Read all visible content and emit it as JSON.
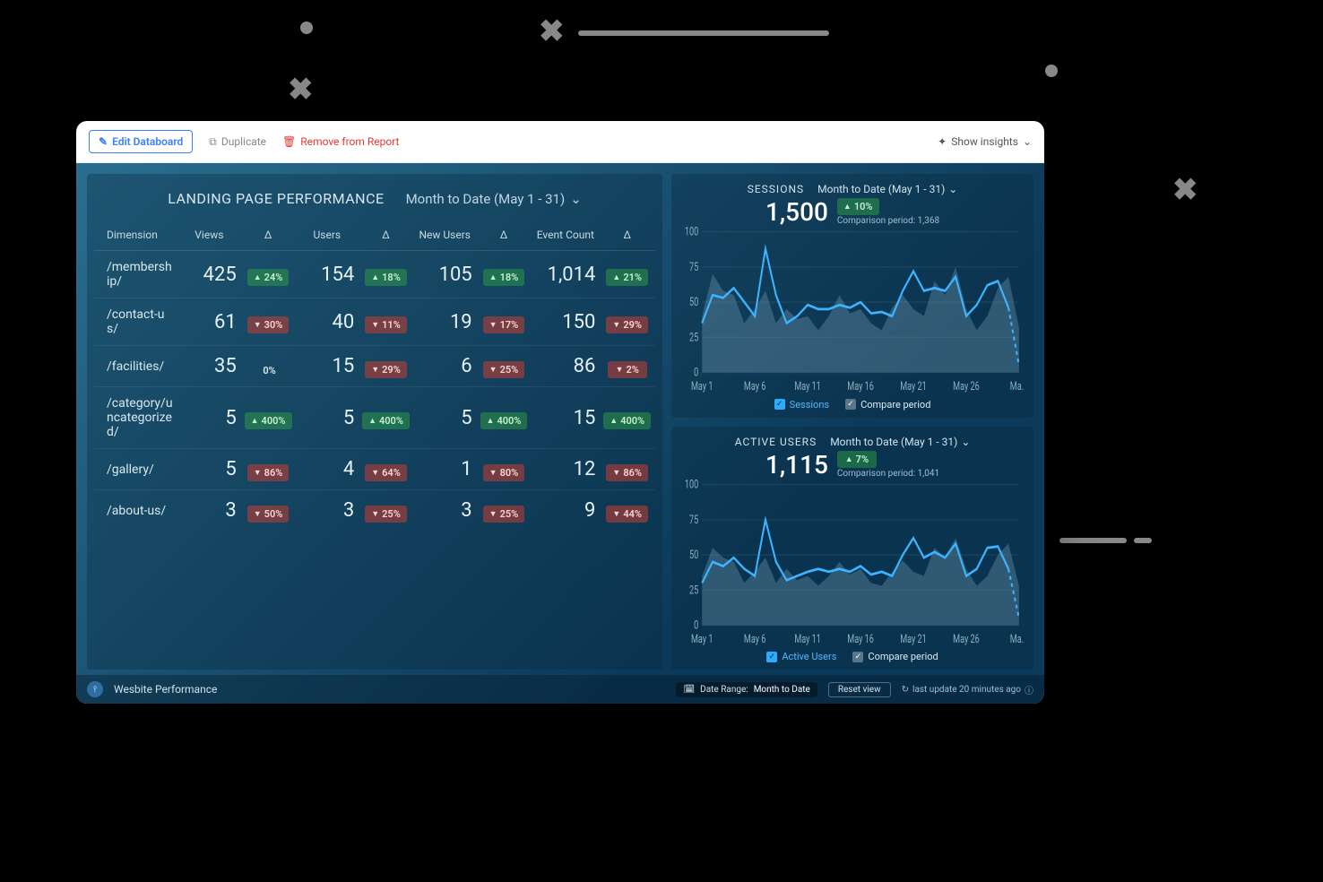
{
  "toolbar": {
    "edit": "Edit Databoard",
    "duplicate": "Duplicate",
    "remove": "Remove from Report",
    "insights": "Show insights"
  },
  "table": {
    "title": "LANDING PAGE PERFORMANCE",
    "range": "Month to Date (May 1 - 31)",
    "columns": {
      "dim": "Dimension",
      "views": "Views",
      "users": "Users",
      "new_users": "New Users",
      "events": "Event Count",
      "delta": "Δ"
    },
    "rows": [
      {
        "dim": "/membership/",
        "views": "425",
        "views_d": {
          "dir": "up",
          "v": "24%"
        },
        "users": "154",
        "users_d": {
          "dir": "up",
          "v": "18%"
        },
        "nu": "105",
        "nu_d": {
          "dir": "up",
          "v": "18%"
        },
        "ev": "1,014",
        "ev_d": {
          "dir": "up",
          "v": "21%"
        }
      },
      {
        "dim": "/contact-us/",
        "views": "61",
        "views_d": {
          "dir": "down",
          "v": "30%"
        },
        "users": "40",
        "users_d": {
          "dir": "down",
          "v": "11%"
        },
        "nu": "19",
        "nu_d": {
          "dir": "down",
          "v": "17%"
        },
        "ev": "150",
        "ev_d": {
          "dir": "down",
          "v": "29%"
        }
      },
      {
        "dim": "/facilities/",
        "views": "35",
        "views_d": {
          "dir": "neutral",
          "v": "0%"
        },
        "users": "15",
        "users_d": {
          "dir": "down",
          "v": "29%"
        },
        "nu": "6",
        "nu_d": {
          "dir": "down",
          "v": "25%"
        },
        "ev": "86",
        "ev_d": {
          "dir": "down",
          "v": "2%"
        }
      },
      {
        "dim": "/category/uncategorized/",
        "views": "5",
        "views_d": {
          "dir": "up",
          "v": "400%"
        },
        "users": "5",
        "users_d": {
          "dir": "up",
          "v": "400%"
        },
        "nu": "5",
        "nu_d": {
          "dir": "up",
          "v": "400%"
        },
        "ev": "15",
        "ev_d": {
          "dir": "up",
          "v": "400%"
        }
      },
      {
        "dim": "/gallery/",
        "views": "5",
        "views_d": {
          "dir": "down",
          "v": "86%"
        },
        "users": "4",
        "users_d": {
          "dir": "down",
          "v": "64%"
        },
        "nu": "1",
        "nu_d": {
          "dir": "down",
          "v": "80%"
        },
        "ev": "12",
        "ev_d": {
          "dir": "down",
          "v": "86%"
        }
      },
      {
        "dim": "/about-us/",
        "views": "3",
        "views_d": {
          "dir": "down",
          "v": "50%"
        },
        "users": "3",
        "users_d": {
          "dir": "down",
          "v": "25%"
        },
        "nu": "3",
        "nu_d": {
          "dir": "down",
          "v": "25%"
        },
        "ev": "9",
        "ev_d": {
          "dir": "down",
          "v": "44%"
        }
      }
    ]
  },
  "sessions_chart": {
    "title": "SESSIONS",
    "range": "Month to Date (May 1 - 31)",
    "value": "1,500",
    "delta": {
      "dir": "up",
      "v": "10%"
    },
    "comparison": "Comparison period: 1,368",
    "legend_primary": "Sessions",
    "legend_compare": "Compare period"
  },
  "users_chart": {
    "title": "ACTIVE USERS",
    "range": "Month to Date (May 1 - 31)",
    "value": "1,115",
    "delta": {
      "dir": "up",
      "v": "7%"
    },
    "comparison": "Comparison period: 1,041",
    "legend_primary": "Active Users",
    "legend_compare": "Compare period"
  },
  "footer": {
    "board_name": "Wesbite Performance",
    "date_range_label": "Date Range:",
    "date_range_value": "Month to Date",
    "reset": "Reset view",
    "update": "last update 20 minutes ago"
  },
  "chart_data": [
    {
      "type": "line",
      "title": "SESSIONS",
      "ylabel": "",
      "ylim": [
        0,
        100
      ],
      "yticks": [
        0,
        25,
        50,
        75,
        100
      ],
      "x_categories": [
        "May 1",
        "May 6",
        "May 11",
        "May 16",
        "May 21",
        "May 26",
        "Ma..."
      ],
      "series": [
        {
          "name": "Sessions",
          "values": [
            35,
            55,
            53,
            60,
            50,
            40,
            88,
            55,
            35,
            40,
            48,
            45,
            45,
            48,
            46,
            50,
            42,
            43,
            40,
            58,
            72,
            58,
            60,
            58,
            68,
            40,
            48,
            62,
            65,
            46,
            5
          ]
        },
        {
          "name": "Compare period",
          "values": [
            40,
            70,
            58,
            55,
            35,
            45,
            58,
            35,
            45,
            38,
            40,
            30,
            40,
            55,
            42,
            45,
            35,
            30,
            46,
            55,
            45,
            40,
            65,
            55,
            75,
            45,
            30,
            40,
            60,
            68,
            32
          ]
        }
      ]
    },
    {
      "type": "line",
      "title": "ACTIVE USERS",
      "ylabel": "",
      "ylim": [
        0,
        100
      ],
      "yticks": [
        0,
        25,
        50,
        75,
        100
      ],
      "x_categories": [
        "May 1",
        "May 6",
        "May 11",
        "May 16",
        "May 21",
        "May 26",
        "Ma..."
      ],
      "series": [
        {
          "name": "Active Users",
          "values": [
            30,
            45,
            42,
            48,
            40,
            35,
            75,
            45,
            32,
            35,
            38,
            40,
            38,
            40,
            38,
            42,
            36,
            38,
            35,
            50,
            62,
            48,
            52,
            48,
            58,
            35,
            40,
            55,
            56,
            40,
            5
          ]
        },
        {
          "name": "Compare period",
          "values": [
            35,
            55,
            48,
            45,
            30,
            38,
            48,
            30,
            40,
            32,
            35,
            28,
            35,
            45,
            36,
            40,
            30,
            28,
            38,
            46,
            38,
            35,
            55,
            48,
            62,
            40,
            28,
            35,
            50,
            58,
            28
          ]
        }
      ]
    }
  ]
}
